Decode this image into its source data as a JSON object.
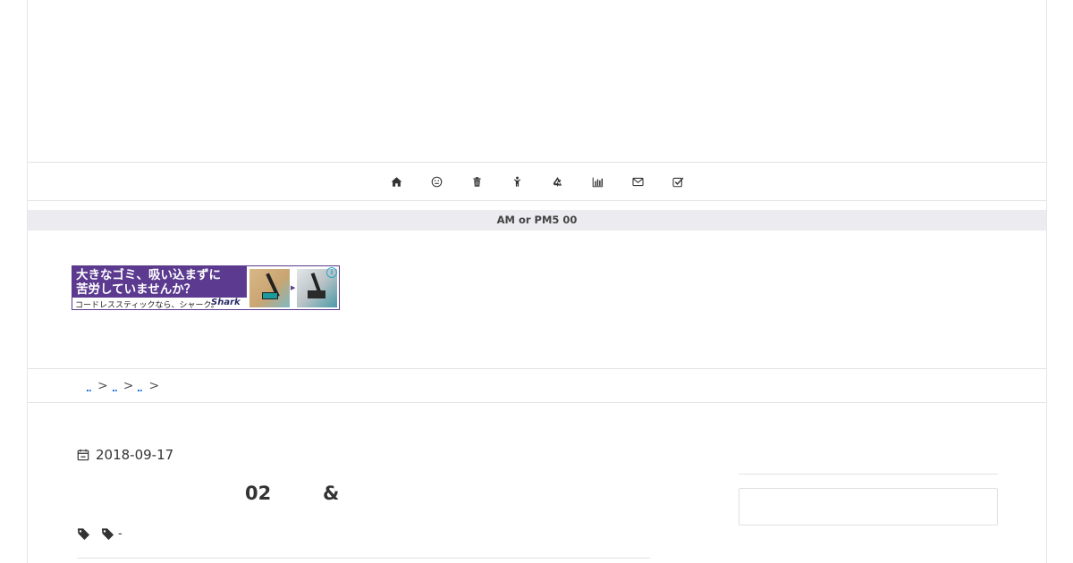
{
  "nav": {
    "icons": [
      "home-icon",
      "smile-icon",
      "trash-icon",
      "child-icon",
      "recycle-icon",
      "bar-chart-icon",
      "envelope-icon",
      "checkbox-icon"
    ]
  },
  "notice": {
    "text": "AM or PM5  00"
  },
  "ad": {
    "headline": "大きなゴミ、吸い込まずに\n苦労していませんか？",
    "sub": "コードレススティックなら、シャーク。",
    "brand": "Shark",
    "info": "i",
    "colors": {
      "background": "#5b3a8f",
      "accent": "#2aa7c7"
    }
  },
  "breadcrumb": {
    "separator": ">"
  },
  "post": {
    "date": "2018-09-17",
    "title_part1": "02",
    "title_part2": "&",
    "tag2_text": "-"
  },
  "sidebar": {
    "search_placeholder": ""
  }
}
